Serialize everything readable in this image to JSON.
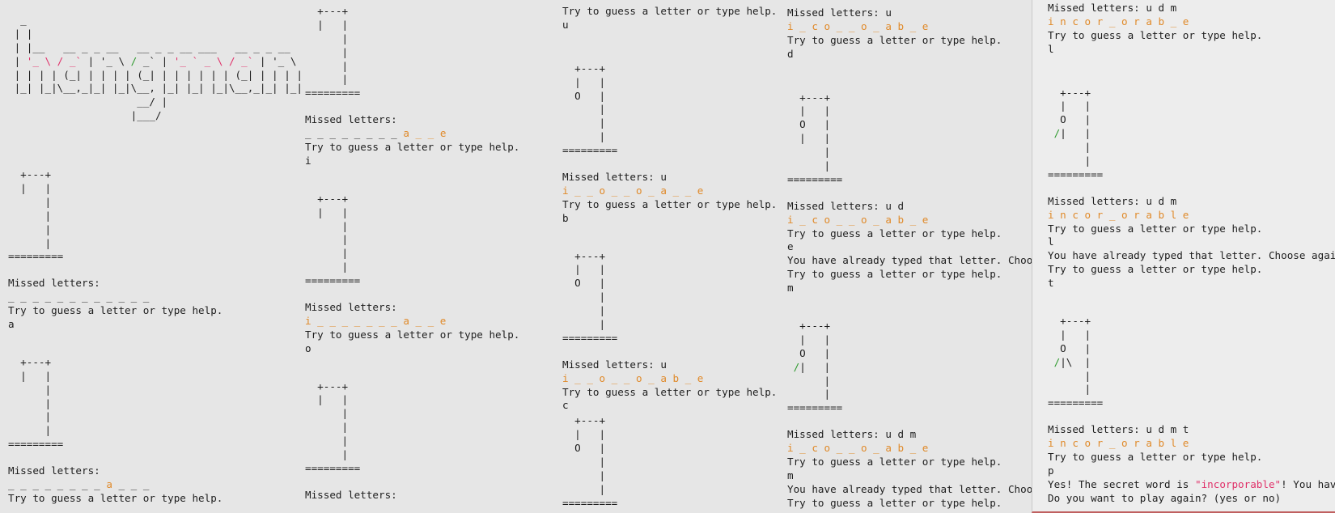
{
  "logo_lines": [
    "  _",
    " | |",
    " | |__   __ _ _ __   __ _ _ __ ___   __ _ _ __",
    " | '_ \\ / _` | '_ \\ / _` | '_ ` _ \\ / _` | '_ \\",
    " | | | | (_| | | | | (_| | | | | | | (_| | | | |",
    " |_| |_|\\__,_|_| |_|\\__, |_| |_| |_|\\__,_|_| |_|",
    "                     __/ |",
    "                    |___/"
  ],
  "gallows": {
    "g0": [
      "  +---+",
      "  |   |",
      "      |",
      "      |",
      "      |",
      "      |",
      "========="
    ],
    "g1": [
      "  +---+",
      "  |   |",
      "  O   |",
      "      |",
      "      |",
      "      |",
      "========="
    ],
    "g2a": [
      "  +---+",
      "  |   |",
      "  O   |",
      "  |   |",
      "      |",
      "      |",
      "========="
    ],
    "g3": [
      "  +---+",
      "  |   |",
      "  O   |",
      " /|   |",
      "      |",
      "      |",
      "========="
    ],
    "g4": [
      "  +---+",
      "  |   |",
      "  O   |",
      " /|\\  |",
      "      |",
      "      |",
      "========="
    ]
  },
  "prompt": "Try to guess a letter or type help.",
  "missed_label": "Missed letters:",
  "already": "You have already typed that letter. Choose again.",
  "already_cut": "You have already typed that letter. Choose",
  "p1": {
    "missed1": "Missed letters:",
    "word1": "_ _ _ _ _ _ _ _ _ _ _ _",
    "input1": "a",
    "missed2": "Missed letters:",
    "word2a": "_ _ _ _ _ _ _ _ ",
    "word2b": "a",
    "word2c": " _ _ _"
  },
  "p2": {
    "word1a": "_ _ _ _ _ _ _ _ ",
    "word1b": "a _ _ e",
    "input1": "i",
    "word2": "i _ _ _ _ _ _ _ a _ _ e",
    "input2": "o",
    "missed3": "Missed letters:"
  },
  "p3": {
    "input0": "u",
    "missed1": "Missed letters: u",
    "word1": "i _ _ o _ _ o _ a _ _ e",
    "input1": "b",
    "missed2": "Missed letters: u",
    "word2": "i _ _ o _ _ o _ a b _ e",
    "input2": "c"
  },
  "p4": {
    "missed0": "Missed letters: u",
    "word0": "i _ c o _ _ o _ a b _ e",
    "input0": "d",
    "missed1": "Missed letters: u d",
    "word1": "i _ c o _ _ o _ a b _ e",
    "input1": "e",
    "input2": "m",
    "missed2": "Missed letters: u d m",
    "word2": "i _ c o _ _ o _ a b _ e",
    "input3": "m"
  },
  "p5": {
    "missed0": "Missed letters: u d m",
    "word0": "i n c o r _ o r a b _ e",
    "input0": "l",
    "missed1": "Missed letters: u d m",
    "word1": "i n c o r _ o r a b l e",
    "input1": "l",
    "input2": "t",
    "missed2": "Missed letters: u d m t",
    "word2": "i n c o r _ o r a b l e",
    "input3": "p",
    "win_a": "Yes! The secret word is ",
    "win_b": "\"incorporable\"",
    "win_c": "! You have wo",
    "again": "Do you want to play again? (yes or no)"
  },
  "colors": {
    "orange": "#e08a2a",
    "pink": "#e0326a",
    "green": "#2e9a2e"
  }
}
